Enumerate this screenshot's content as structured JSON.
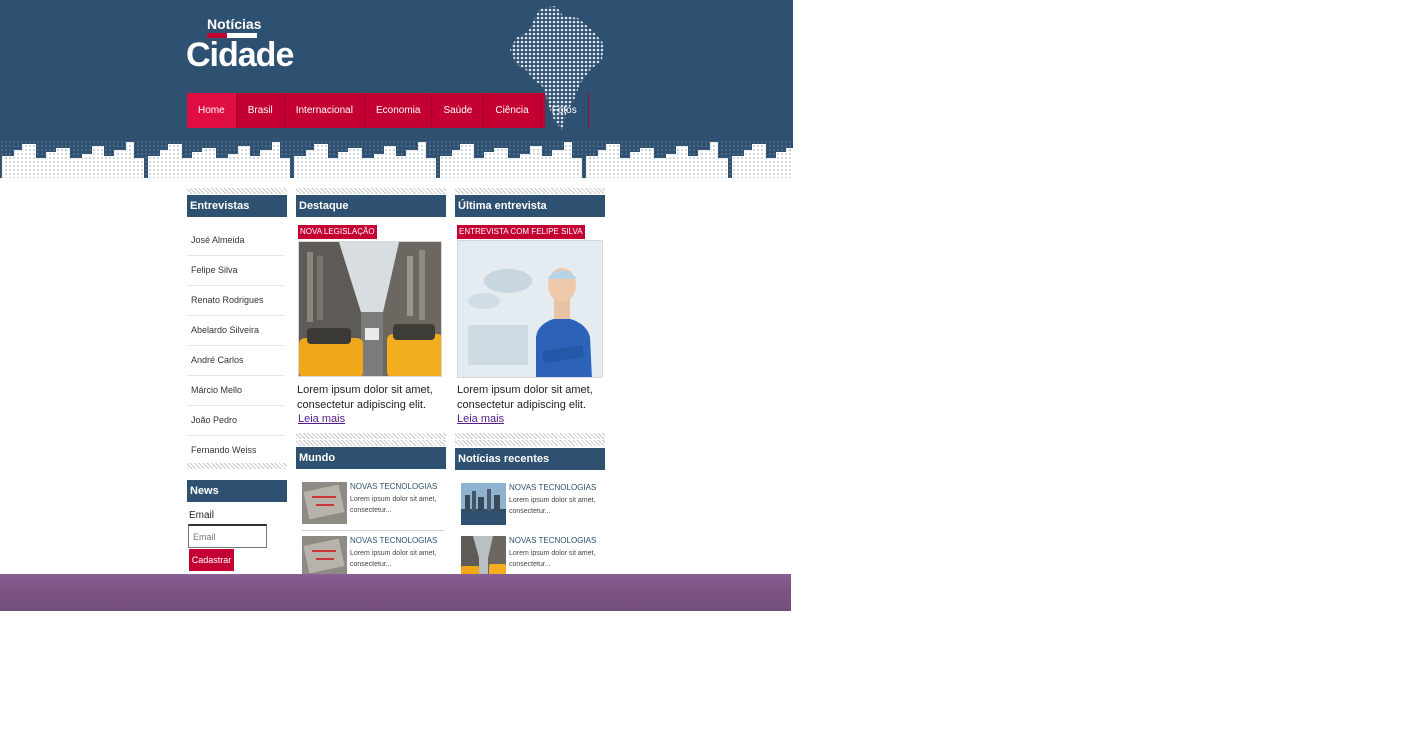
{
  "logo": {
    "top": "Notícias",
    "main": "Cidade"
  },
  "nav": {
    "items": [
      {
        "label": "Home",
        "active": true
      },
      {
        "label": "Brasil"
      },
      {
        "label": "Internacional"
      },
      {
        "label": "Economia"
      },
      {
        "label": "Saúde"
      },
      {
        "label": "Ciência"
      },
      {
        "label": "Fotos"
      }
    ]
  },
  "sidebar": {
    "interviews_title": "Entrevistas",
    "interviews": [
      "José Almeida",
      "Felipe Silva",
      "Renato Rodrigues",
      "Abelardo Silveira",
      "André Carlos",
      "Márcio Mello",
      "João Pedro",
      "Fernando Weiss"
    ],
    "news_title": "News",
    "email_label": "Email",
    "email_placeholder": "Email",
    "subscribe_label": "Cadastrar"
  },
  "destaque": {
    "title": "Destaque",
    "tag": "NOVA LEGISLAÇÃO",
    "text": "Lorem ipsum dolor sit amet, consectetur adipiscing elit.",
    "link": "Leia mais"
  },
  "ultima": {
    "title": "Última entrevista",
    "tag": "ENTREVISTA COM FELIPE SILVA",
    "text": "Lorem ipsum dolor sit amet, consectetur adipiscing elit.",
    "link": "Leia mais"
  },
  "mundo": {
    "title": "Mundo",
    "items": [
      {
        "title": "NOVAS TECNOLOGIAS",
        "desc": "Lorem ipsum dolor sit amet, consectetur..."
      },
      {
        "title": "NOVAS TECNOLOGIAS",
        "desc": "Lorem ipsum dolor sit amet, consectetur..."
      }
    ]
  },
  "recentes": {
    "title": "Notícias recentes",
    "items": [
      {
        "title": "NOVAS TECNOLOGIAS",
        "desc": "Lorem ipsum dolor sit amet, consectetur..."
      },
      {
        "title": "NOVAS TECNOLOGIAS",
        "desc": "Lorem ipsum dolor sit amet, consectetur..."
      }
    ]
  },
  "colors": {
    "navy": "#2e5171",
    "red": "#c40033",
    "footer_purple": "#7c5584"
  },
  "icons": {
    "map": "brazil-map-icon",
    "skyline": "city-skyline-illustration"
  }
}
